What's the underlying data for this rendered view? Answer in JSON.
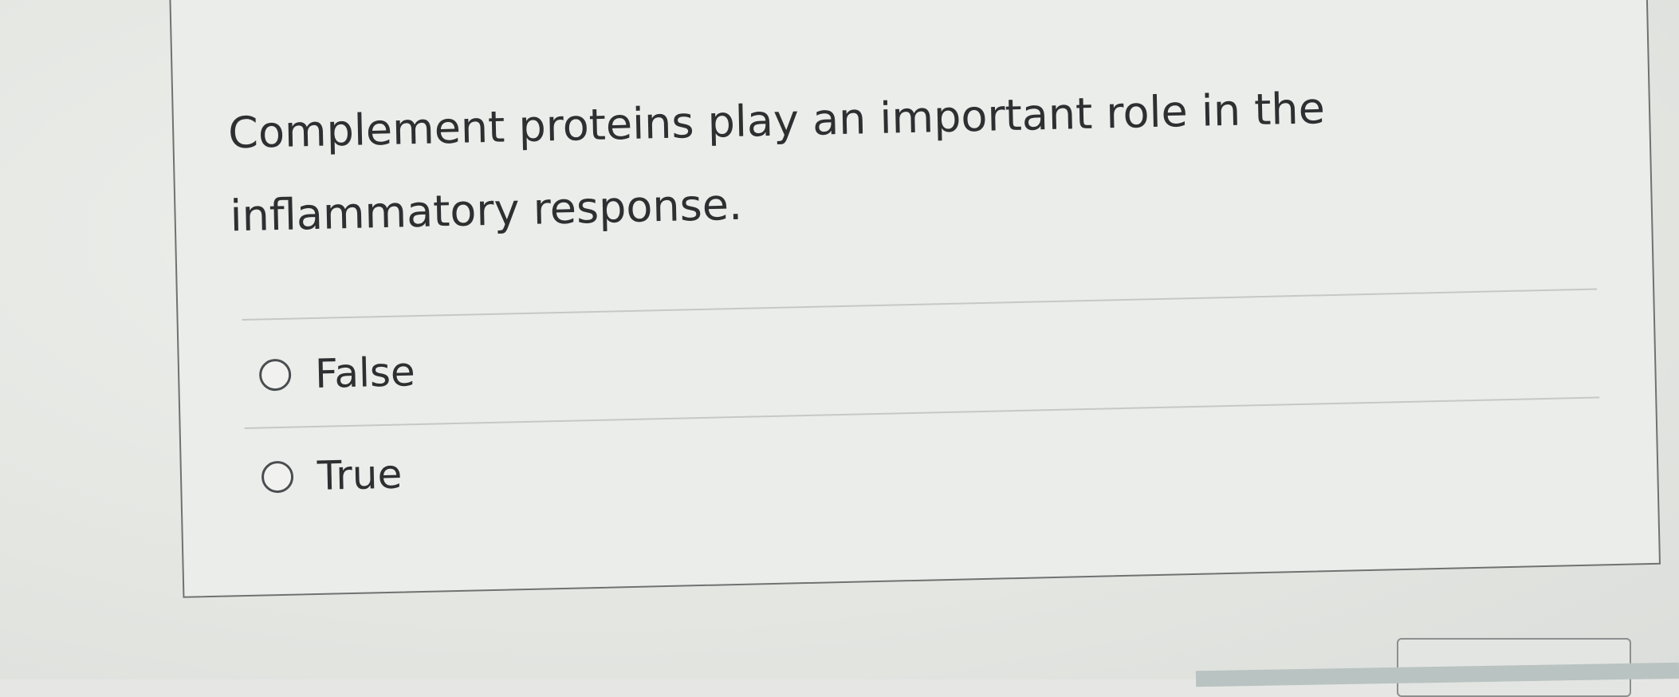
{
  "question": {
    "text": "Complement proteins play an important role in the inflammatory response."
  },
  "options": [
    {
      "label": "False",
      "selected": false
    },
    {
      "label": "True",
      "selected": false
    }
  ],
  "colors": {
    "background": "#e6e7e4",
    "card": "#ebedea",
    "border": "#6f7270",
    "text": "#2d2f31"
  }
}
